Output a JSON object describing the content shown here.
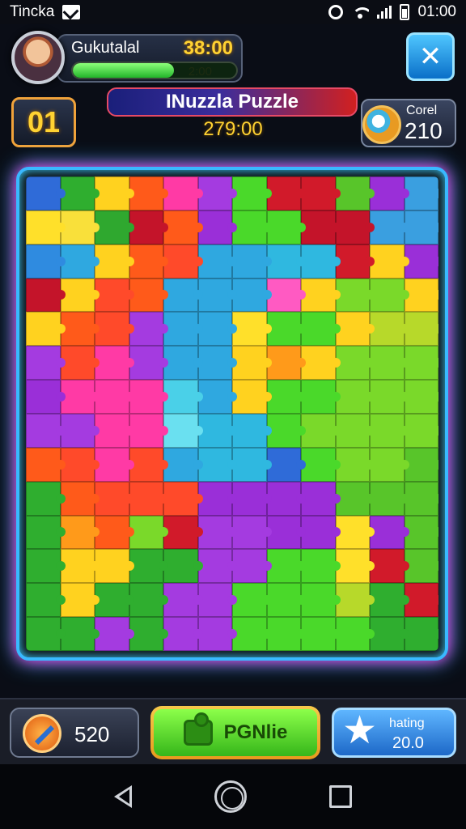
{
  "status_bar": {
    "carrier": "Tincka",
    "time": "01:00"
  },
  "player": {
    "name": "Gukutalal",
    "score": "38:00",
    "progress_label": "2:00",
    "progress": 0.62
  },
  "level": {
    "number": "01"
  },
  "title": {
    "text": "INuzzla Puzzle",
    "timer": "279:00"
  },
  "coins": {
    "label": "Corel",
    "value": "210"
  },
  "board": {
    "columns": 12,
    "rows": 14,
    "pieces": [
      "#2f6bd8",
      "#2fae2f",
      "#ffd21f",
      "#ff5a1a",
      "#ff3aa5",
      "#a43be0",
      "#4ad92a",
      "#d11a2a",
      "#d11a2a",
      "#58c52a",
      "#9a2fd8",
      "#3a9fe0",
      "#ffe02a",
      "#f9e03a",
      "#2fa82f",
      "#c4142a",
      "#ff5a1a",
      "#9a2fd8",
      "#4ad92a",
      "#4ad92a",
      "#c4142a",
      "#c4142a",
      "#3a9fe0",
      "#3a9fe0",
      "#2f8be0",
      "#2fa8e0",
      "#ffd21f",
      "#ff5a1a",
      "#ff4a2a",
      "#2fa8e0",
      "#2fa8e0",
      "#2fb8e0",
      "#2fb8e0",
      "#d11a2a",
      "#ffd21f",
      "#9a2fd8",
      "#c4142a",
      "#ffd21f",
      "#ff4a2a",
      "#ff5a1a",
      "#2fa8e0",
      "#2fa8e0",
      "#2fa8e0",
      "#ff5ac2",
      "#ffd21f",
      "#7ad92a",
      "#7ad92a",
      "#ffd21f",
      "#ffd21f",
      "#ff5a1a",
      "#ff4a2a",
      "#a43be0",
      "#2fa8e0",
      "#2fa8e0",
      "#ffe02a",
      "#4ad92a",
      "#4ad92a",
      "#ffd21f",
      "#b7d92a",
      "#b7d92a",
      "#a43be0",
      "#ff4a2a",
      "#ff3aa5",
      "#a43be0",
      "#2fa8e0",
      "#2fa8e0",
      "#ffd21f",
      "#ff9a1a",
      "#ffd21f",
      "#7ad92a",
      "#7ad92a",
      "#7ad92a",
      "#9a2fd8",
      "#ff3aa5",
      "#ff3aa5",
      "#ff3aa5",
      "#4ad0e8",
      "#2fa8e0",
      "#ffd21f",
      "#4ad92a",
      "#4ad92a",
      "#7ad92a",
      "#7ad92a",
      "#7ad92a",
      "#a43be0",
      "#a43be0",
      "#ff3aa5",
      "#ff3aa5",
      "#6ae0f0",
      "#2fb8e0",
      "#2fb8e0",
      "#4ad92a",
      "#7ad92a",
      "#7ad92a",
      "#7ad92a",
      "#7ad92a",
      "#ff5a1a",
      "#ff4a2a",
      "#ff3aa5",
      "#ff4a2a",
      "#2fa8e0",
      "#2fb8e0",
      "#2fb8e0",
      "#2f6bd8",
      "#4ad92a",
      "#7ad92a",
      "#7ad92a",
      "#58c52a",
      "#2fae2f",
      "#ff5a1a",
      "#ff4a2a",
      "#ff4a2a",
      "#ff4a2a",
      "#9a2fd8",
      "#9a2fd8",
      "#9a2fd8",
      "#9a2fd8",
      "#58c52a",
      "#58c52a",
      "#58c52a",
      "#2fae2f",
      "#ff9a1a",
      "#ff5a1a",
      "#7ad92a",
      "#d11a2a",
      "#a43be0",
      "#a43be0",
      "#9a2fd8",
      "#9a2fd8",
      "#ffe02a",
      "#9a2fd8",
      "#58c52a",
      "#2fae2f",
      "#ffd21f",
      "#ffd21f",
      "#2fae2f",
      "#2fae2f",
      "#a43be0",
      "#a43be0",
      "#4ad92a",
      "#4ad92a",
      "#ffe02a",
      "#d11a2a",
      "#58c52a",
      "#2fae2f",
      "#ffd21f",
      "#2fae2f",
      "#2fae2f",
      "#a43be0",
      "#a43be0",
      "#4ad92a",
      "#4ad92a",
      "#4ad92a",
      "#b7d92a",
      "#2fae2f",
      "#d11a2a",
      "#2fae2f",
      "#2fae2f",
      "#a43be0",
      "#2fae2f",
      "#a43be0",
      "#a43be0",
      "#4ad92a",
      "#4ad92a",
      "#4ad92a",
      "#4ad92a",
      "#2fae2f",
      "#2fae2f"
    ]
  },
  "hints": {
    "value": "520"
  },
  "play_button": {
    "label": "PGNlie"
  },
  "rating": {
    "label": "hating",
    "value": "20.0"
  }
}
